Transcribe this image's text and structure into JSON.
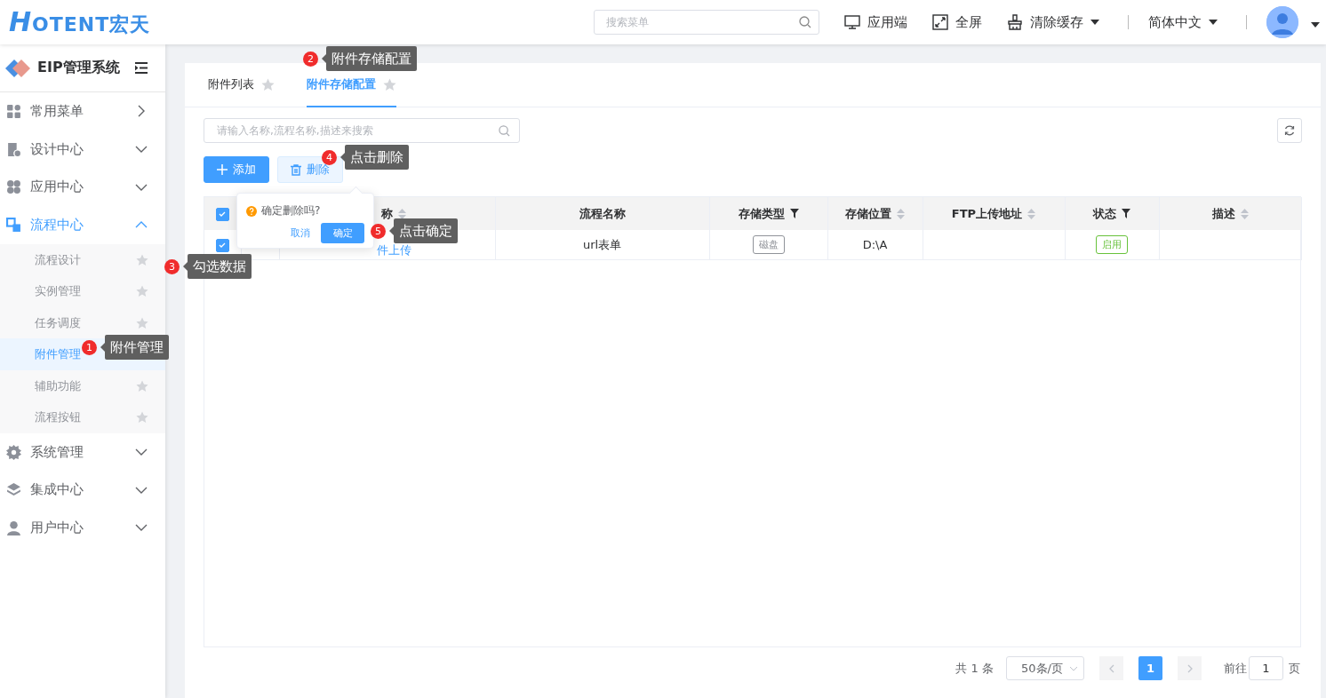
{
  "header": {
    "logo": {
      "mark": "H",
      "text": "OTENT宏天"
    },
    "search": {
      "placeholder": "搜索菜单"
    },
    "actions": [
      {
        "kind": "monitor",
        "label": "应用端",
        "dropdown": false
      },
      {
        "kind": "fullscreen",
        "label": "全屏",
        "dropdown": false
      },
      {
        "kind": "broom",
        "label": "清除缓存",
        "dropdown": true
      }
    ],
    "language": "简体中文"
  },
  "sidebar": {
    "title": "EIP管理系统",
    "items": [
      {
        "label": "常用菜单",
        "kind": "link",
        "expanded": false
      },
      {
        "label": "设计中心",
        "kind": "group",
        "expanded": false
      },
      {
        "label": "应用中心",
        "kind": "group",
        "expanded": false
      },
      {
        "label": "流程中心",
        "kind": "group",
        "expanded": true,
        "children": [
          {
            "label": "流程设计",
            "selected": false,
            "star": true
          },
          {
            "label": "实例管理",
            "selected": false,
            "star": true
          },
          {
            "label": "任务调度",
            "selected": false,
            "star": true
          },
          {
            "label": "附件管理",
            "selected": true,
            "star": false
          },
          {
            "label": "辅助功能",
            "selected": false,
            "star": true
          },
          {
            "label": "流程按钮",
            "selected": false,
            "star": true
          }
        ]
      },
      {
        "label": "系统管理",
        "kind": "group",
        "expanded": false
      },
      {
        "label": "集成中心",
        "kind": "group",
        "expanded": false
      },
      {
        "label": "用户中心",
        "kind": "group",
        "expanded": false
      }
    ]
  },
  "tabs": [
    {
      "label": "附件列表",
      "selected": false
    },
    {
      "label": "附件存储配置",
      "selected": true
    }
  ],
  "search": {
    "placeholder": "请输入名称,流程名称,描述来搜索"
  },
  "buttons": [
    {
      "kind": "add",
      "label": "添加"
    },
    {
      "kind": "delete",
      "label": "删除"
    }
  ],
  "table": {
    "columns": [
      {
        "kind": "select",
        "checked": true
      },
      {
        "kind": "blank"
      },
      {
        "kind": "sort",
        "label": "称"
      },
      {
        "kind": "plain",
        "label": "流程名称"
      },
      {
        "kind": "filter",
        "label": "存储类型"
      },
      {
        "kind": "sort",
        "label": "存储位置"
      },
      {
        "kind": "sort",
        "label": "FTP上传地址"
      },
      {
        "kind": "filter",
        "label": "状态"
      },
      {
        "kind": "sort",
        "label": "描述"
      }
    ],
    "rows": [
      [
        {
          "kind": "select",
          "checked": true
        },
        {
          "kind": "blank"
        },
        {
          "kind": "link",
          "text": "件上传"
        },
        {
          "kind": "text",
          "text": "url表单"
        },
        {
          "kind": "tag",
          "text": "磁盘",
          "color": "#909399"
        },
        {
          "kind": "text",
          "text": "D:\\A"
        },
        {
          "kind": "blank"
        },
        {
          "kind": "tag",
          "text": "启用",
          "color": "#67c23a"
        },
        {
          "kind": "blank"
        }
      ]
    ]
  },
  "popconfirm": {
    "message": "确定删除吗?",
    "cancel": "取消",
    "confirm": "确定"
  },
  "pagination": {
    "total": "共 1 条",
    "page_size": "50条/页",
    "pages": [
      {
        "label": "1",
        "selected": true
      }
    ],
    "goto_label": "前往",
    "goto_value": "1",
    "goto_suffix": "页"
  },
  "callouts": [
    {
      "number": "1",
      "text": "附件管理"
    },
    {
      "number": "2",
      "text": "附件存储配置"
    },
    {
      "number": "3",
      "text": "勾选数据"
    },
    {
      "number": "4",
      "text": "点击删除"
    },
    {
      "number": "5",
      "text": "点击确定"
    }
  ]
}
